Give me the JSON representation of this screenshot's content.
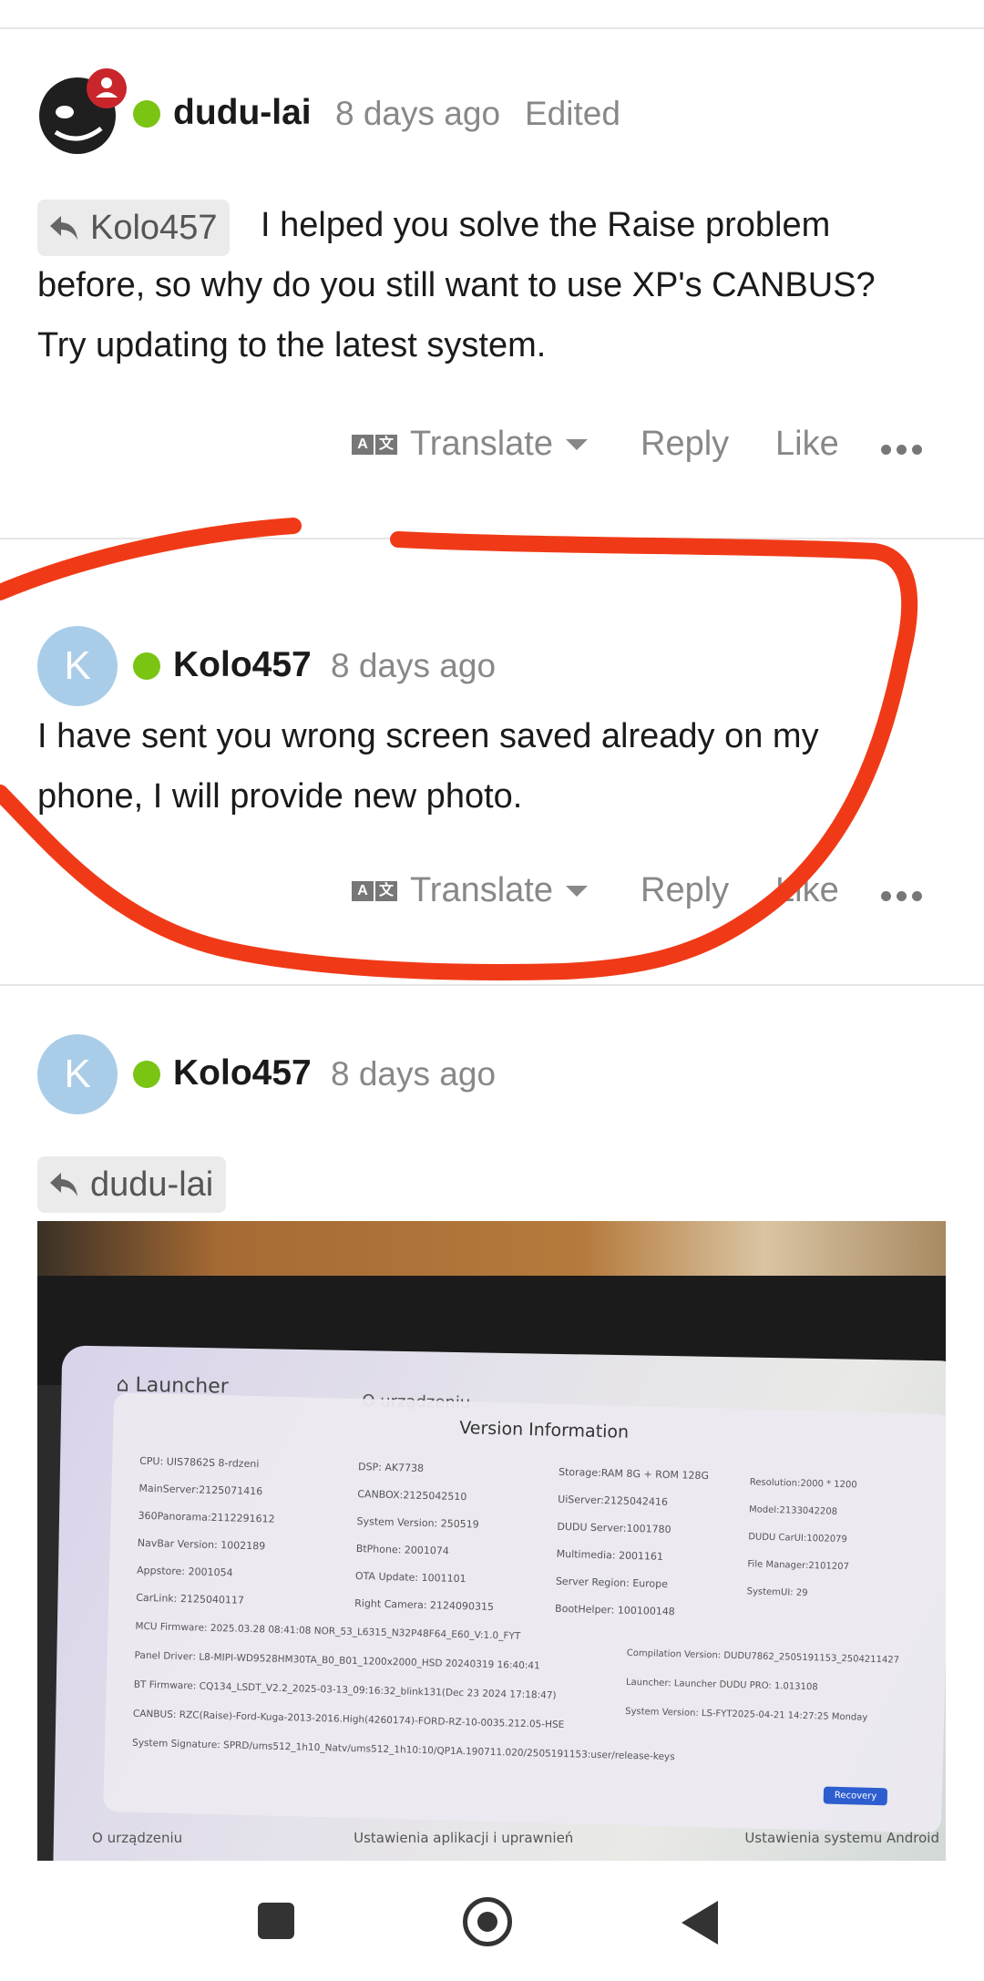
{
  "posts": [
    {
      "username": "dudu-lai",
      "time": "8 days ago",
      "edited": "Edited",
      "quote": "Kolo457",
      "text_line1": "I helped you solve the Raise problem",
      "text_line2": "before, so why do you still want to use XP's CANBUS?",
      "text_line3": "Try updating to the latest system."
    },
    {
      "avatar_letter": "K",
      "username": "Kolo457",
      "time": "8 days ago",
      "text_line1": "I have sent you wrong screen saved already on my",
      "text_line2": "phone, I will provide new photo."
    },
    {
      "avatar_letter": "K",
      "username": "Kolo457",
      "time": "8 days ago",
      "quote": "dudu-lai"
    }
  ],
  "actions": {
    "translate": "Translate",
    "reply": "Reply",
    "like": "Like"
  },
  "photo": {
    "launcher": "Launcher",
    "title": "Version Information",
    "col1": [
      "CPU: UIS7862S 8-rdzeni",
      "MainServer:2125071416",
      "360Panorama:2112291612",
      "NavBar Version: 1002189",
      "Appstore: 2001054",
      "CarLink: 2125040117"
    ],
    "col2": [
      "DSP: AK7738",
      "CANBOX:2125042510",
      "System Version: 250519",
      "BtPhone: 2001074",
      "OTA Update: 1001101",
      "Right Camera: 2124090315"
    ],
    "col3": [
      "Storage:RAM 8G + ROM 128G",
      "UiServer:2125042416",
      "DUDU Server:1001780",
      "Multimedia: 2001161",
      "Server Region: Europe",
      "BootHelper: 100100148"
    ],
    "col4": [
      "Resolution:2000 * 1200",
      "Model:2133042208",
      "DUDU CarUI:1002079",
      "File Manager:2101207",
      "SystemUI: 29"
    ],
    "long_lines": [
      "MCU Firmware: 2025.03.28 08:41:08 NOR_53_L6315_N32P48F64_E60_V:1.0_FYT",
      "Panel Driver: L8-MIPI-WD9528HM30TA_B0_B01_1200x2000_HSD 20240319 16:40:41",
      "BT Firmware: CQ134_LSDT_V2.2_2025-03-13_09:16:32_blink131(Dec 23 2024 17:18:47)",
      "CANBUS: RZC(Raise)-Ford-Kuga-2013-2016.High(4260174)-FORD-RZ-10-0035.212.05-HSE",
      "System Signature: SPRD/ums512_1h10_Natv/ums512_1h10:10/QP1A.190711.020/2505191153:user/release-keys"
    ],
    "right_lines": [
      "Compilation Version: DUDU7862_2505191153_2504211427",
      "Launcher: Launcher DUDU PRO: 1.013108",
      "System Version: LS-FYT2025-04-21 14:27:25 Monday"
    ],
    "recovery": "Recovery",
    "bottom_menu": [
      "O urządzeniu",
      "Ustawienia aplikacji i uprawnień",
      "Ustawienia systemu Android"
    ],
    "header_partial": "O urządzeniu"
  },
  "colors": {
    "annotation": "#f03a17",
    "online": "#7ac414",
    "avatar": "#a9cde8"
  }
}
